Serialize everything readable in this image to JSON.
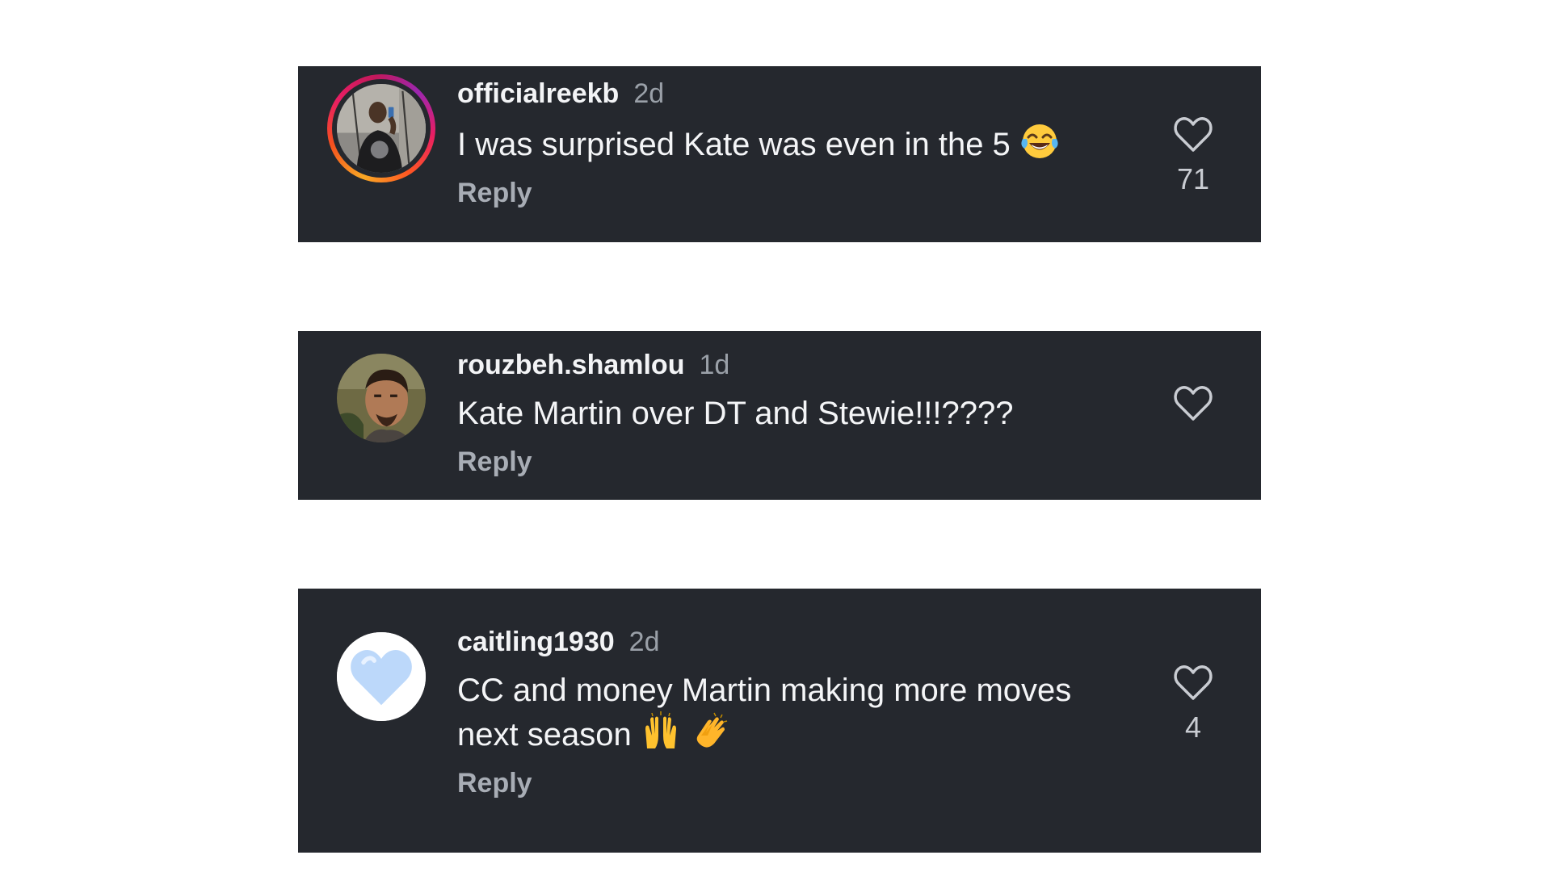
{
  "comments": [
    {
      "username": "officialreekb",
      "time": "2d",
      "text": "I was surprised Kate was even in the 5",
      "emoji": [
        "face-with-tears-of-joy"
      ],
      "reply_label": "Reply",
      "likes": "71",
      "avatar": "profile-photo-with-story-ring"
    },
    {
      "username": "rouzbeh.shamlou",
      "time": "1d",
      "text": "Kate Martin over DT and Stewie!!!????",
      "emoji": [],
      "reply_label": "Reply",
      "likes": "",
      "avatar": "profile-photo"
    },
    {
      "username": "caitling1930",
      "time": "2d",
      "text_line1": "CC and money Martin making more moves",
      "text_line2": "next season",
      "emoji": [
        "raising-hands",
        "clapping-hands"
      ],
      "reply_label": "Reply",
      "likes": "4",
      "avatar": "light-blue-heart"
    }
  ],
  "colors": {
    "card_background": "#25282e",
    "page_background": "#ffffff",
    "username": "#f3f4f6",
    "timestamp": "#9aa0a8",
    "reply": "#a8adb5"
  }
}
